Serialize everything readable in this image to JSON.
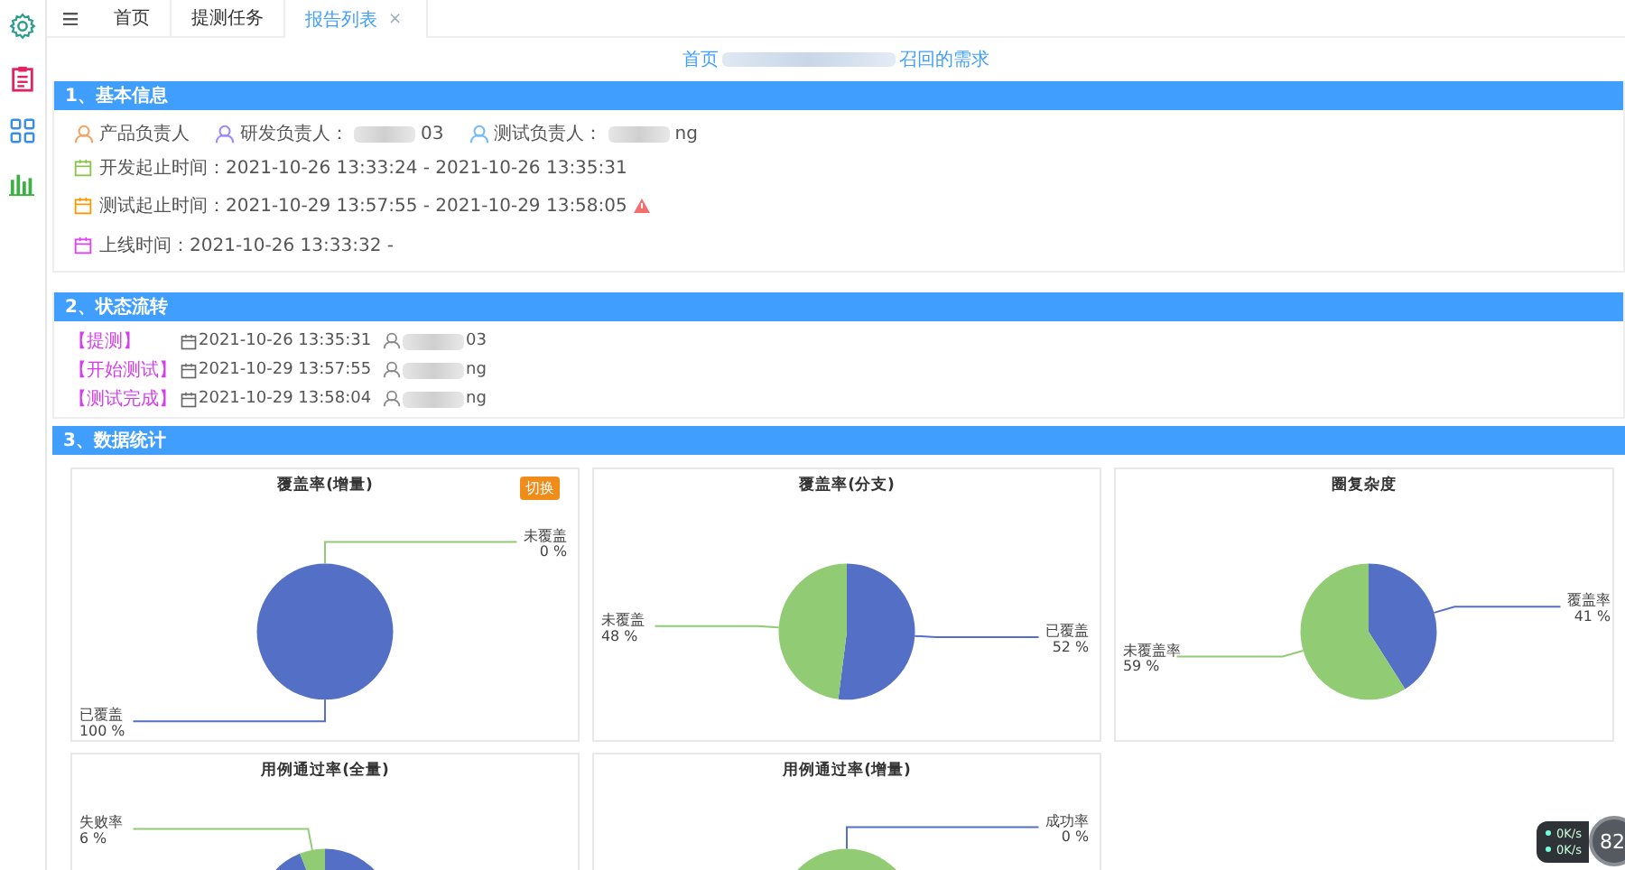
{
  "sidebar": {
    "items": [
      {
        "kind": "gear",
        "color": "#2a9d8f"
      },
      {
        "kind": "clipboard",
        "color": "#e0245e"
      },
      {
        "kind": "grid",
        "color": "#3a8ee6"
      },
      {
        "kind": "bars",
        "color": "#3cb043"
      }
    ]
  },
  "tabs": [
    {
      "label": "首页",
      "selected": false
    },
    {
      "label": "提测任务",
      "selected": false
    },
    {
      "label": "报告列表",
      "selected": true,
      "close_glyph": "×"
    }
  ],
  "page_title": {
    "prefix": "首页",
    "suffix": "召回的需求"
  },
  "basic_info": {
    "title": "1、基本信息",
    "people": [
      {
        "label": "产品负责人",
        "color": "#f4a261"
      },
      {
        "label": "研发负责人：",
        "name_tail": "03",
        "color": "#9c88ff"
      },
      {
        "label": "测试负责人：",
        "name_tail": "ng",
        "color": "#74b9ff"
      }
    ],
    "dates": [
      {
        "text": "开发起止时间：2021-10-26 13:33:24 - 2021-10-26 13:35:31",
        "color": "#8bc34a",
        "warning": false
      },
      {
        "text": "测试起止时间：2021-10-29 13:57:55 - 2021-10-29 13:58:05",
        "color": "#ff9800",
        "warning": true
      },
      {
        "text": "上线时间：2021-10-26 13:33:32 -",
        "color": "#e040fb",
        "warning": false
      }
    ]
  },
  "status_flow": {
    "title": "2、状态流转",
    "events": [
      {
        "status": "【提测】",
        "time": "2021-10-26 13:35:31",
        "user_tail": "03"
      },
      {
        "status": "【开始测试】",
        "time": "2021-10-29 13:57:55",
        "user_tail": "ng"
      },
      {
        "status": "【测试完成】",
        "time": "2021-10-29 13:58:04",
        "user_tail": "ng"
      }
    ]
  },
  "statistics": {
    "title": "3、数据统计",
    "charts": [
      {
        "title": "覆盖率(增量)",
        "switch_button": "切换",
        "chart_data": {
          "type": "pie",
          "categories": [
            "已覆盖",
            "未覆盖"
          ],
          "values": [
            100,
            0
          ],
          "value_labels": [
            "100 %",
            "0 %"
          ]
        }
      },
      {
        "title": "覆盖率(分支)",
        "chart_data": {
          "type": "pie",
          "categories": [
            "已覆盖",
            "未覆盖"
          ],
          "values": [
            52,
            48
          ],
          "value_labels": [
            "52 %",
            "48 %"
          ]
        }
      },
      {
        "title": "圈复杂度",
        "chart_data": {
          "type": "pie",
          "categories": [
            "覆盖率",
            "未覆盖率"
          ],
          "values": [
            41,
            59
          ],
          "value_labels": [
            "41 %",
            "59 %"
          ]
        }
      },
      {
        "title": "用例通过率(全量)",
        "chart_data": {
          "type": "pie",
          "categories": [
            null,
            "失败率"
          ],
          "values": [
            94,
            6
          ],
          "value_labels": [
            null,
            "6 %"
          ]
        }
      },
      {
        "title": "用例通过率(增量)",
        "chart_data": {
          "type": "pie",
          "categories": [
            "成功率",
            null
          ],
          "values": [
            0,
            100
          ],
          "value_labels": [
            "0 %",
            null
          ]
        }
      }
    ]
  },
  "speed_widget": {
    "rates": [
      "0K/s",
      "0K/s"
    ],
    "score": "82"
  }
}
